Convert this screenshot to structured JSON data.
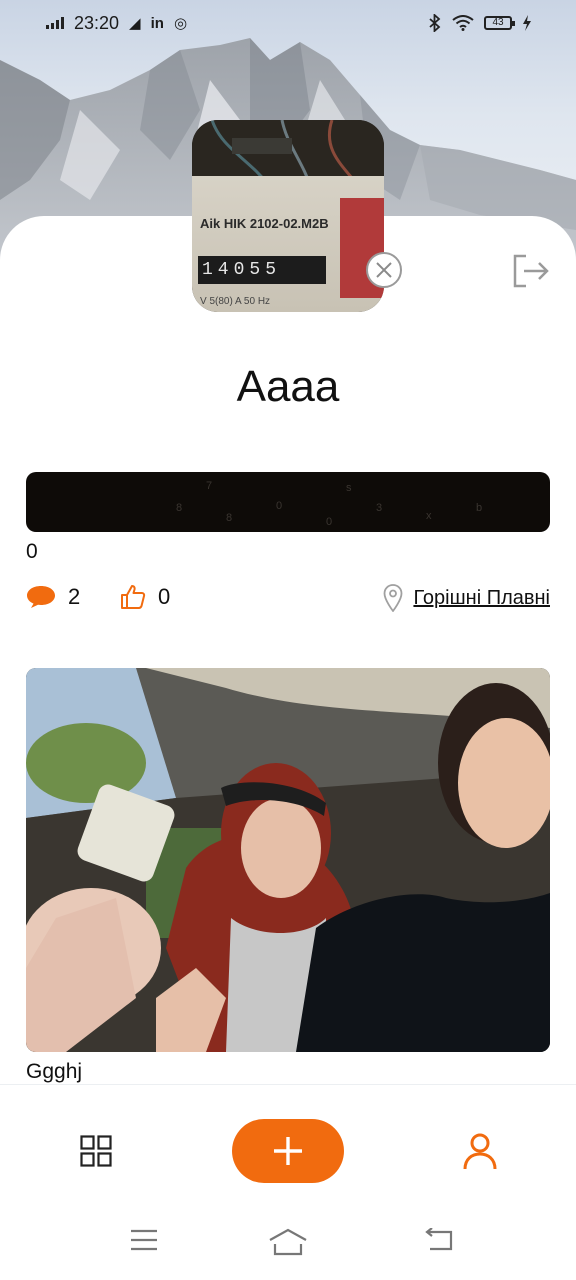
{
  "status_bar": {
    "time": "23:20",
    "battery": "43",
    "icons": [
      "signal-icon",
      "telegram-icon",
      "linkedin-icon",
      "instagram-icon",
      "bluetooth-icon",
      "wifi-icon",
      "battery-icon",
      "charging-icon"
    ],
    "left_glyphs": {
      "telegram": "◢",
      "linkedin": "in",
      "instagram": "◎"
    }
  },
  "profile": {
    "username": "Aaaa",
    "avatar_meter_label": "Aik HIK 2102-02.M2B",
    "avatar_meter_digits": "14055",
    "avatar_meter_spec": "V   5(80) A   50 Hz"
  },
  "posts": [
    {
      "caption": "0",
      "comments": "2",
      "likes": "0",
      "location": "Горішні Плавні"
    },
    {
      "caption": "Ggghj"
    }
  ],
  "bottom_nav": {
    "items": [
      "grid-icon",
      "add-icon",
      "profile-icon"
    ]
  },
  "colors": {
    "accent": "#f16b0f",
    "text": "#111111",
    "muted": "#9a9a9a"
  }
}
